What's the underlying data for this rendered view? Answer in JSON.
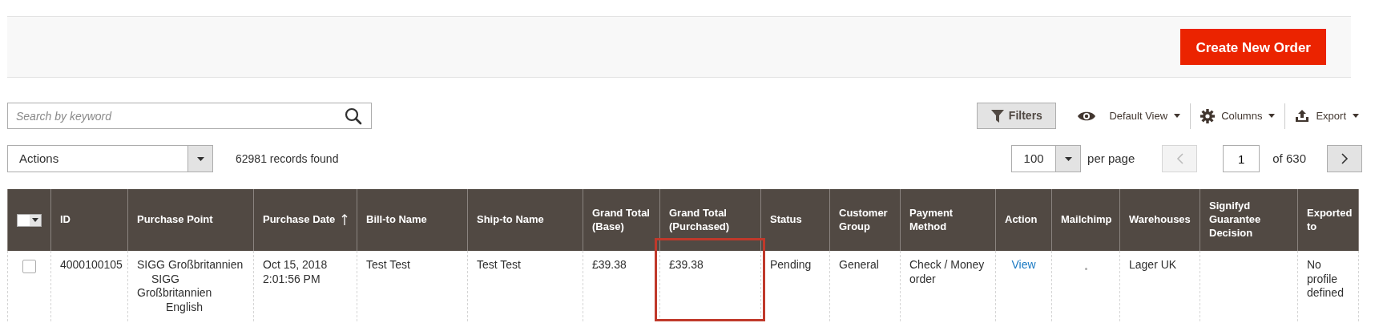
{
  "header": {
    "create_button": "Create New Order"
  },
  "search": {
    "placeholder": "Search by keyword"
  },
  "toolbar": {
    "filters": "Filters",
    "view": "Default View",
    "columns": "Columns",
    "export": "Export"
  },
  "actions": {
    "value": "Actions"
  },
  "records": "62981 records found",
  "pagination": {
    "per_page_value": "100",
    "per_page_label": "per page",
    "page": "1",
    "total": "of 630",
    "prev_disabled": true,
    "next_disabled": false
  },
  "table": {
    "select_all_checked": false,
    "columns": [
      {
        "label": "ID",
        "sorted": false,
        "highlighted": false
      },
      {
        "label": "Purchase Point",
        "sorted": false,
        "highlighted": false
      },
      {
        "label": "Purchase Date",
        "sorted": true,
        "highlighted": false
      },
      {
        "label": "Bill-to Name",
        "sorted": false,
        "highlighted": false
      },
      {
        "label": "Ship-to Name",
        "sorted": false,
        "highlighted": false
      },
      {
        "label": "Grand Total (Base)",
        "sorted": false,
        "highlighted": false
      },
      {
        "label": "Grand Total (Purchased)",
        "sorted": false,
        "highlighted": true
      },
      {
        "label": "Status",
        "sorted": false,
        "highlighted": false
      },
      {
        "label": "Customer Group",
        "sorted": false,
        "highlighted": false
      },
      {
        "label": "Payment Method",
        "sorted": false,
        "highlighted": false
      },
      {
        "label": "Action",
        "sorted": false,
        "highlighted": false
      },
      {
        "label": "Mailchimp",
        "sorted": false,
        "highlighted": false
      },
      {
        "label": "Warehouses",
        "sorted": false,
        "highlighted": false
      },
      {
        "label": "Signifyd Guarantee Decision",
        "sorted": false,
        "highlighted": false
      },
      {
        "label": "Exported to",
        "sorted": false,
        "highlighted": false
      }
    ],
    "rows": [
      {
        "checked": false,
        "cells": [
          {
            "kind": "text",
            "text": "4000100105"
          },
          {
            "kind": "tree",
            "text": "SIGG Großbritannien",
            "children": [
              {
                "text": "SIGG Großbritannien",
                "children": [
                  {
                    "text": "English"
                  }
                ]
              }
            ]
          },
          {
            "kind": "text",
            "text": "Oct 15, 2018 2:01:56 PM"
          },
          {
            "kind": "text",
            "text": "Test Test"
          },
          {
            "kind": "text",
            "text": "Test Test"
          },
          {
            "kind": "text",
            "text": "£39.38"
          },
          {
            "kind": "text",
            "text": "£39.38"
          },
          {
            "kind": "text",
            "text": "Pending"
          },
          {
            "kind": "text",
            "text": "General"
          },
          {
            "kind": "text",
            "text": "Check / Money order"
          },
          {
            "kind": "link",
            "text": "View"
          },
          {
            "kind": "dot"
          },
          {
            "kind": "text",
            "text": "Lager UK"
          },
          {
            "kind": "empty"
          },
          {
            "kind": "text",
            "text": "No profile defined"
          }
        ]
      }
    ]
  }
}
